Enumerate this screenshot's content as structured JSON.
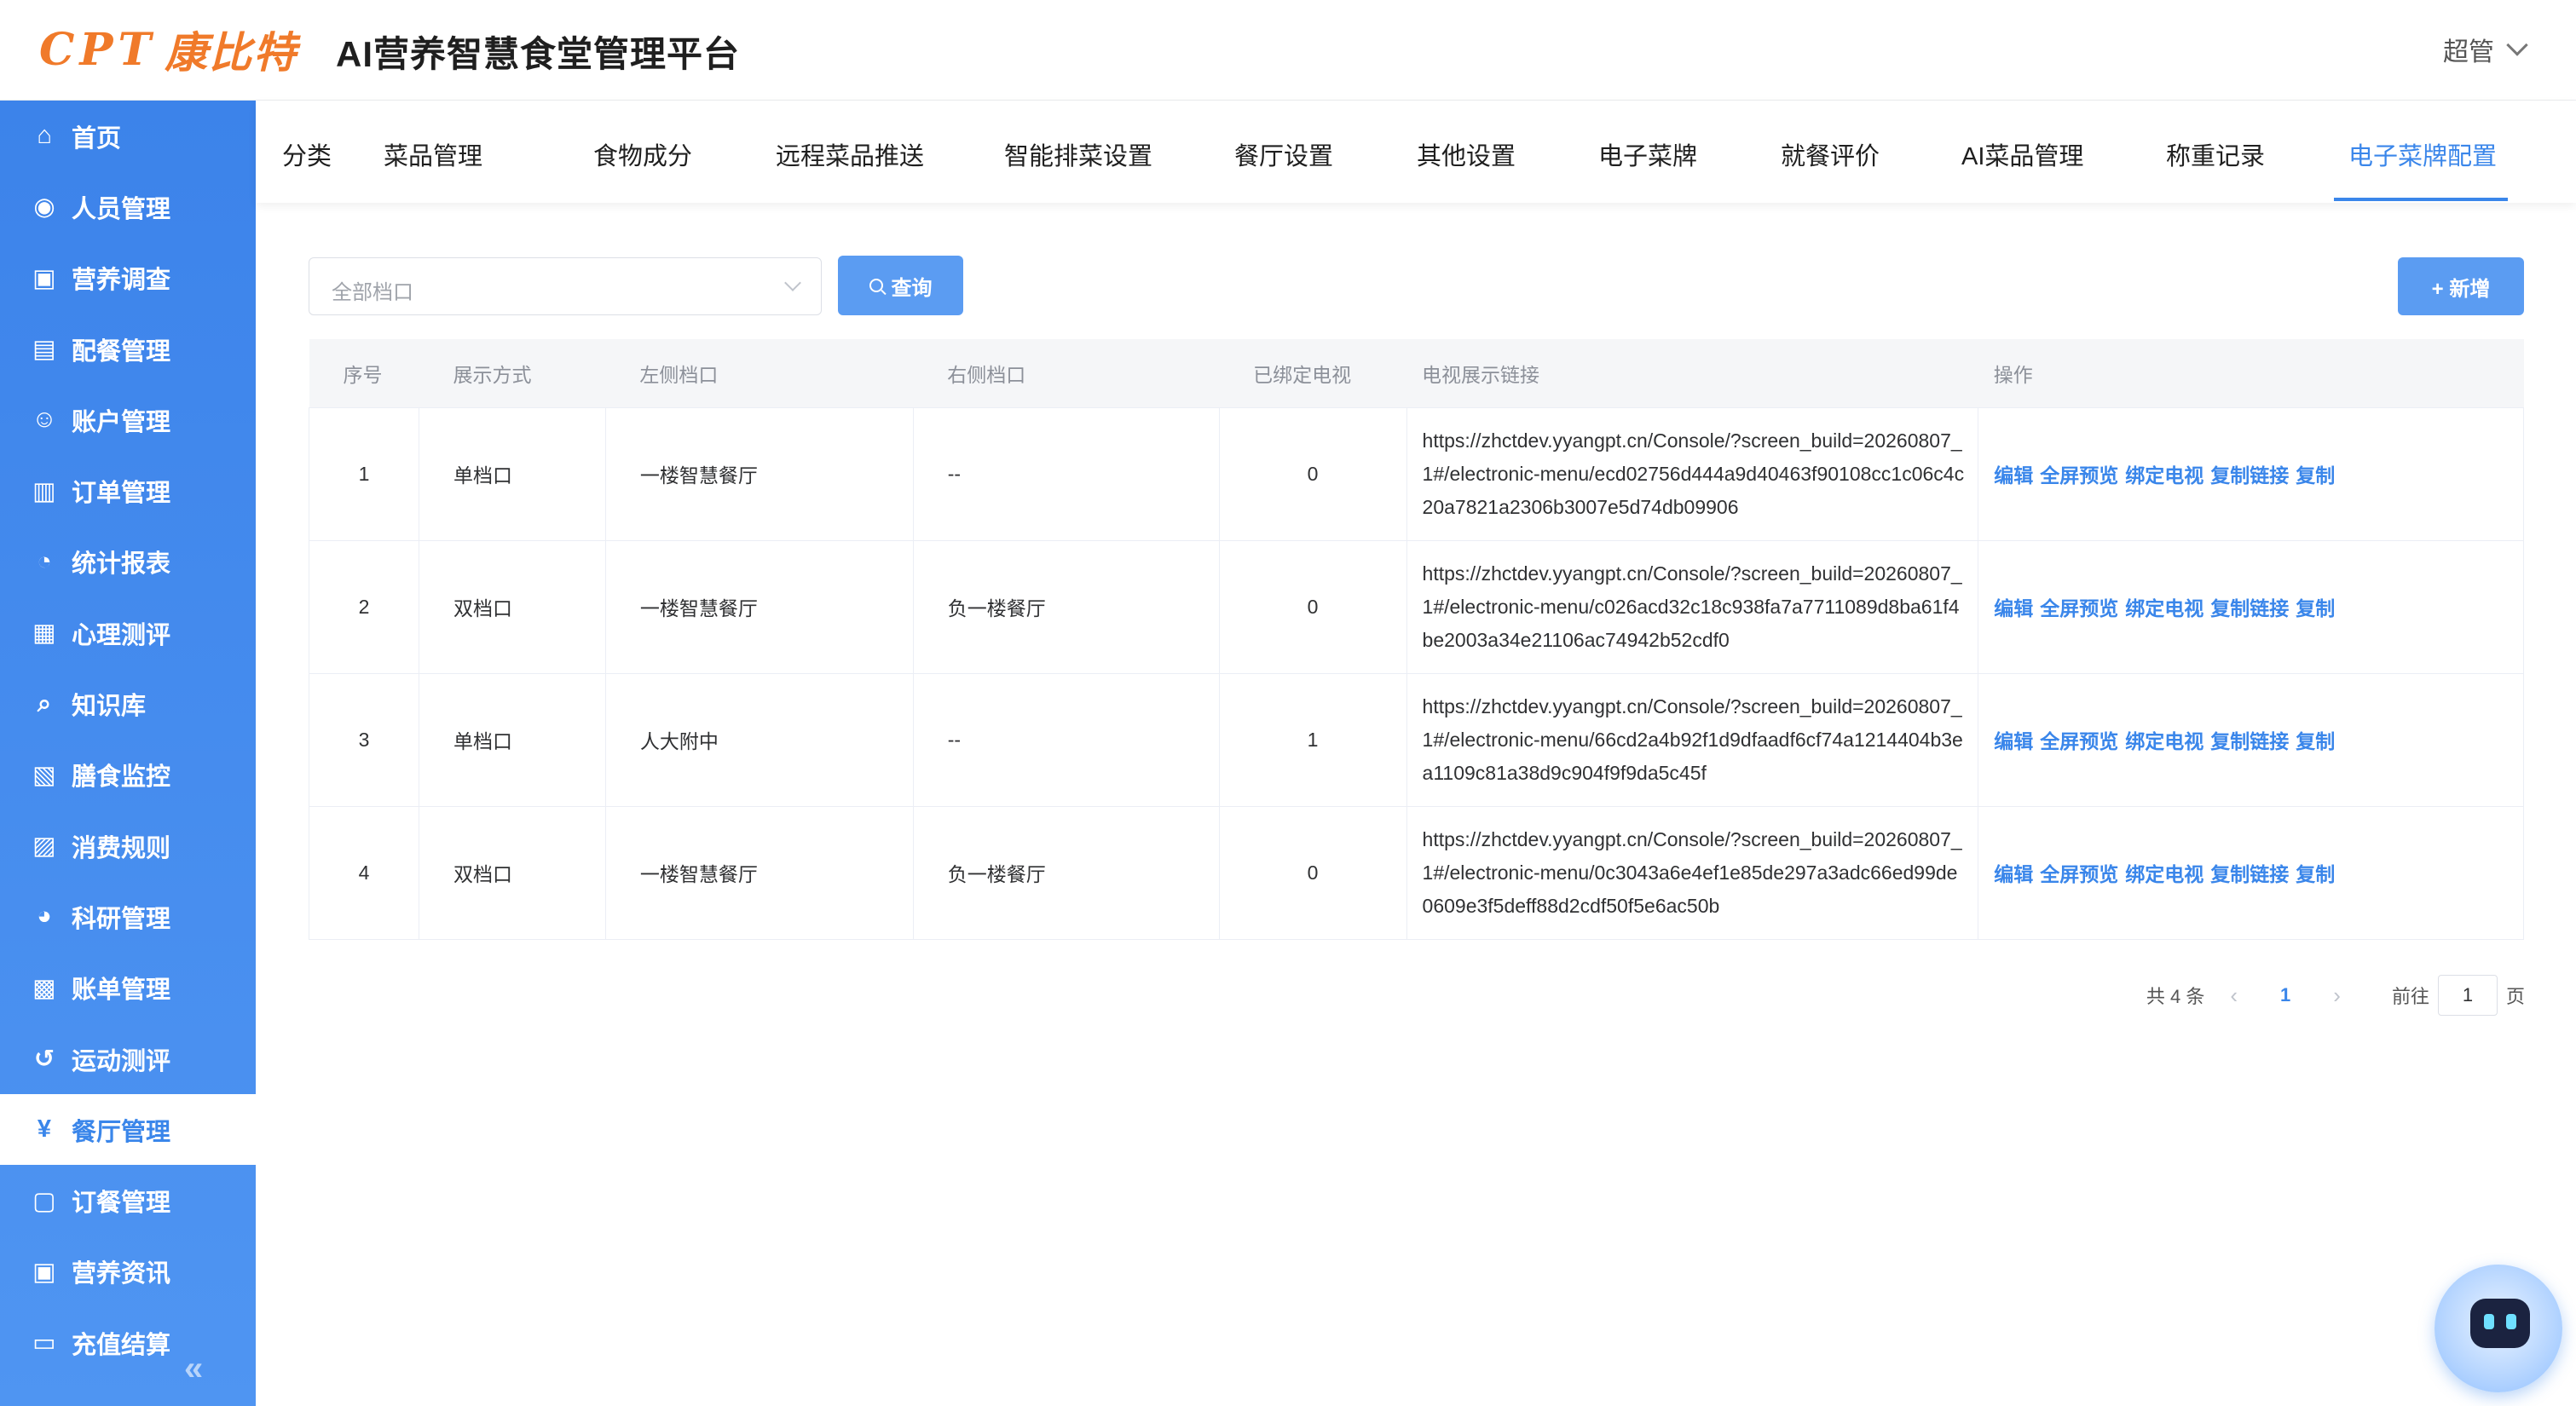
{
  "header": {
    "logo_mark": "CPT",
    "logo_cn": "康比特",
    "title": "AI营养智慧食堂管理平台",
    "user": "超管"
  },
  "sidebar": {
    "items": [
      {
        "label": "首页",
        "icon": "home-icon"
      },
      {
        "label": "人员管理",
        "icon": "people-icon"
      },
      {
        "label": "营养调查",
        "icon": "survey-icon"
      },
      {
        "label": "配餐管理",
        "icon": "meal-plan-icon"
      },
      {
        "label": "账户管理",
        "icon": "account-icon"
      },
      {
        "label": "订单管理",
        "icon": "order-icon"
      },
      {
        "label": "统计报表",
        "icon": "pie-chart-icon"
      },
      {
        "label": "心理测评",
        "icon": "document-icon"
      },
      {
        "label": "知识库",
        "icon": "knowledge-icon"
      },
      {
        "label": "膳食监控",
        "icon": "monitor-icon"
      },
      {
        "label": "消费规则",
        "icon": "bar-chart-icon"
      },
      {
        "label": "科研管理",
        "icon": "research-icon"
      },
      {
        "label": "账单管理",
        "icon": "bill-icon"
      },
      {
        "label": "运动测评",
        "icon": "sport-icon"
      },
      {
        "label": "餐厅管理",
        "icon": "fork-knife-icon",
        "active": true
      },
      {
        "label": "订餐管理",
        "icon": "booking-icon"
      },
      {
        "label": "营养资讯",
        "icon": "news-icon"
      },
      {
        "label": "充值结算",
        "icon": "wallet-icon"
      }
    ]
  },
  "tabs": [
    {
      "label": "分类"
    },
    {
      "label": "菜品管理"
    },
    {
      "label": "食物成分"
    },
    {
      "label": "远程菜品推送"
    },
    {
      "label": "智能排菜设置"
    },
    {
      "label": "餐厅设置"
    },
    {
      "label": "其他设置"
    },
    {
      "label": "电子菜牌"
    },
    {
      "label": "就餐评价"
    },
    {
      "label": "AI菜品管理"
    },
    {
      "label": "称重记录"
    },
    {
      "label": "电子菜牌配置",
      "active": true
    }
  ],
  "toolbar": {
    "filter_placeholder": "全部档口",
    "query_label": "查询",
    "add_label": "+ 新增"
  },
  "table": {
    "headers": [
      "序号",
      "展示方式",
      "左侧档口",
      "右侧档口",
      "已绑定电视",
      "电视展示链接",
      "操作"
    ],
    "rows": [
      {
        "no": "1",
        "mode": "单档口",
        "left": "一楼智慧餐厅",
        "right": "--",
        "bound": "0",
        "link": "https://zhctdev.yyangpt.cn/Console/?screen_build=20260807_1#/electronic-menu/ecd02756d444a9d40463f90108cc1c06c4c20a7821a2306b3007e5d74db09906"
      },
      {
        "no": "2",
        "mode": "双档口",
        "left": "一楼智慧餐厅",
        "right": "负一楼餐厅",
        "bound": "0",
        "link": "https://zhctdev.yyangpt.cn/Console/?screen_build=20260807_1#/electronic-menu/c026acd32c18c938fa7a7711089d8ba61f4be2003a34e21106ac74942b52cdf0"
      },
      {
        "no": "3",
        "mode": "单档口",
        "left": "人大附中",
        "right": "--",
        "bound": "1",
        "link": "https://zhctdev.yyangpt.cn/Console/?screen_build=20260807_1#/electronic-menu/66cd2a4b92f1d9dfaadf6cf74a1214404b3ea1109c81a38d9c904f9f9da5c45f"
      },
      {
        "no": "4",
        "mode": "双档口",
        "left": "一楼智慧餐厅",
        "right": "负一楼餐厅",
        "bound": "0",
        "link": "https://zhctdev.yyangpt.cn/Console/?screen_build=20260807_1#/electronic-menu/0c3043a6e4ef1e85de297a3adc66ed99de0609e3f5deff88d2cdf50f5e6ac50b"
      }
    ],
    "actions": [
      "编辑",
      "全屏预览",
      "绑定电视",
      "复制链接",
      "复制"
    ]
  },
  "pagination": {
    "total": "共 4 条",
    "current": "1",
    "goto_label": "前往",
    "goto_value": "1",
    "page_unit": "页"
  },
  "colors": {
    "brand": "#f07a2a",
    "accent": "#3a86ea",
    "sidebar": "#4a90f0"
  }
}
